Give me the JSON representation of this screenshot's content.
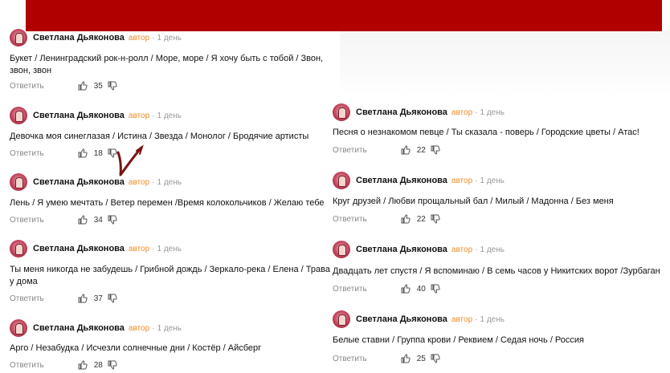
{
  "common": {
    "author": "Светлана Дьяконова",
    "badge": "автор",
    "separator": "·",
    "time": "1 день",
    "reply_label": "Ответить"
  },
  "left_comments": [
    {
      "text": "Букет / Ленинградский рок-н-ролл / Море, море / Я хочу быть с тобой / Звон, звон, звон",
      "likes": "35"
    },
    {
      "text": "Девочка моя синеглазая / Истина / Звезда / Монолог / Бродячие артисты",
      "likes": "18"
    },
    {
      "text": "Лень / Я умею мечтать / Ветер перемен /Время колокольчиков / Желаю тебе",
      "likes": "34"
    },
    {
      "text": "Ты меня никогда не забудешь / Грибной дождь / Зеркало-река / Елена / Трава у дома",
      "likes": "37"
    },
    {
      "text": "Арго / Незабудка / Исчезли солнечные дни / Костёр / Айсберг",
      "likes": "28"
    }
  ],
  "right_comments": [
    {
      "text": "Песня о незнакомом певце / Ты сказала - поверь / Городские цветы / Атас!",
      "likes": "22"
    },
    {
      "text": "Круг друзей / Любви прощальный бал / Милый / Мадонна / Без меня",
      "likes": "22"
    },
    {
      "text": "Двадцать лет спустя / Я вспоминаю / В семь часов у Никитских ворот /Зурбаган",
      "likes": "40"
    },
    {
      "text": "Белые ставни / Группа крови / Реквием / Седая ночь / Россия",
      "likes": "25"
    }
  ],
  "colors": {
    "banner": "#b00000",
    "badge": "#f08c2a",
    "checkmark": "#7a1414"
  },
  "icons": [
    "thumbs-up-icon",
    "thumbs-down-icon",
    "checkmark-annotation-icon"
  ]
}
